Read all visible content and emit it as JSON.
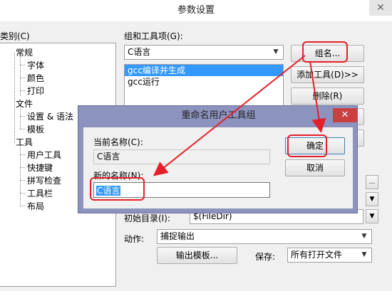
{
  "window": {
    "title": "参数设置",
    "close_icon": "close-icon"
  },
  "left_panel": {
    "category_label": "类别(C)",
    "tree": [
      {
        "label": "常规",
        "level": 0
      },
      {
        "label": "字体",
        "level": 1
      },
      {
        "label": "颜色",
        "level": 1
      },
      {
        "label": "打印",
        "level": 1
      },
      {
        "label": "文件",
        "level": 0
      },
      {
        "label": "设置 & 语法",
        "level": 1
      },
      {
        "label": "模板",
        "level": 1
      },
      {
        "label": "工具",
        "level": 0
      },
      {
        "label": "用户工具",
        "level": 1,
        "selected": true
      },
      {
        "label": "快捷键",
        "level": 1
      },
      {
        "label": "拼写检查",
        "level": 1
      },
      {
        "label": "工具栏",
        "level": 1
      },
      {
        "label": "布局",
        "level": 1
      }
    ]
  },
  "right_panel": {
    "group_label": "组和工具项(G):",
    "group_combo_value": "C语言",
    "group_button": "组名...",
    "tool_list": [
      {
        "label": "gcc编译并生成",
        "selected": true
      },
      {
        "label": "gcc运行",
        "selected": false
      }
    ],
    "add_tool_button": "添加工具(D)>>",
    "delete_button": "删除(R)",
    "init_dir_label": "初始目录(I):",
    "init_dir_value": "$(FileDir)",
    "action_label": "动作:",
    "action_value": "捕捉输出",
    "output_template_button": "输出模板...",
    "save_label": "保存:",
    "save_value": "所有打开文件"
  },
  "dialog": {
    "title": "重命名用户工具组",
    "current_name_label": "当前名称(C):",
    "current_name_value": "C语言",
    "new_name_label": "新的名称(N):",
    "new_name_value": "C语言",
    "ok_button": "确定",
    "cancel_button": "取消"
  },
  "colors": {
    "highlight": "#3399ff",
    "annotation_red": "#e5202a",
    "dialog_frame": "#8d93bf"
  }
}
